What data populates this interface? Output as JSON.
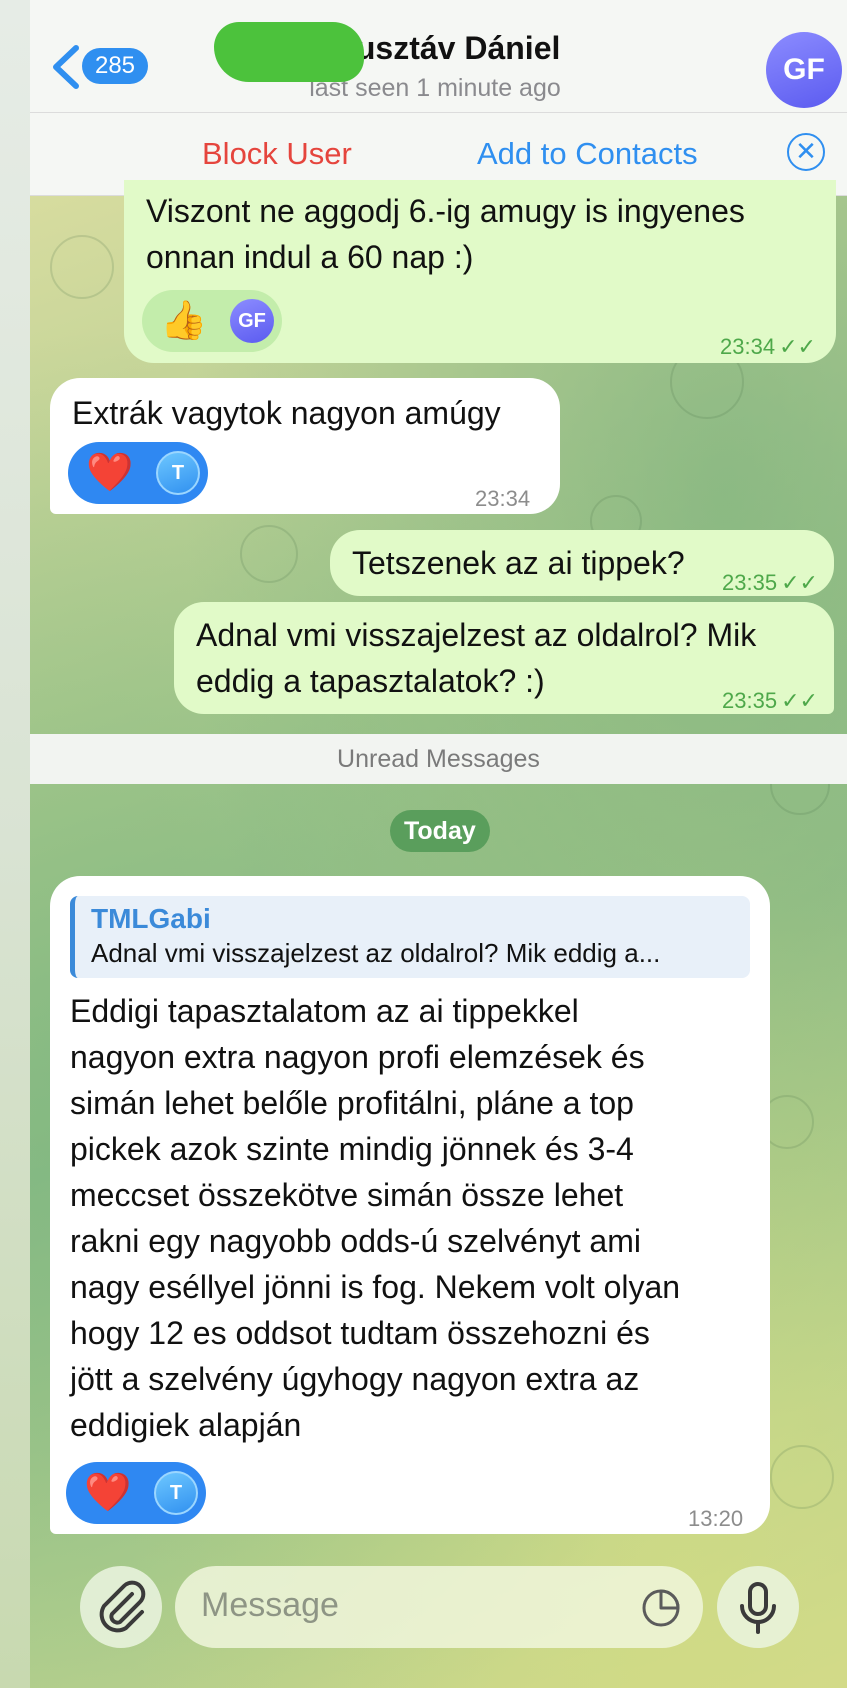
{
  "header": {
    "unread_count": "285",
    "contact_name": "r Gusztáv Dániel",
    "status": "last seen 1 minute ago",
    "avatar_initials": "GF"
  },
  "actions": {
    "block_user": "Block User",
    "add_to_contacts": "Add to Contacts"
  },
  "messages": [
    {
      "direction": "outgoing",
      "text_lines": [
        "Viszont ne aggodj 6.-ig amugy is ingyenes",
        "onnan indul a 60 nap :)"
      ],
      "reaction_emoji": "👍",
      "reaction_user": "GF",
      "time": "23:34",
      "read": true
    },
    {
      "direction": "incoming",
      "text": "Extrák vagytok nagyon amúgy",
      "reaction_emoji": "❤️",
      "reaction_user": "T",
      "time": "23:34"
    },
    {
      "direction": "outgoing",
      "text": "Tetszenek az ai tippek?",
      "time": "23:35",
      "read": true
    },
    {
      "direction": "outgoing",
      "text_lines": [
        "Adnal vmi visszajelzest az oldalrol? Mik",
        "eddig a tapasztalatok? :)"
      ],
      "time": "23:35",
      "read": true
    }
  ],
  "unread_separator": "Unread Messages",
  "date_separator": "Today",
  "reply_message": {
    "quoted_author": "TMLGabi",
    "quoted_text": "Adnal vmi visszajelzest az oldalrol? Mik eddig a...",
    "text_lines": [
      "Eddigi tapasztalatom az ai tippekkel",
      "nagyon extra nagyon profi elemzések és",
      "simán lehet belőle profitálni, pláne a top",
      "pickek azok szinte mindig jönnek és 3-4",
      "meccset összekötve simán össze lehet",
      "rakni egy nagyobb odds-ú szelvényt ami",
      "nagy eséllyel jönni is fog. Nekem volt olyan",
      "hogy 12 es oddsot tudtam összehozni és",
      "jött a szelvény úgyhogy nagyon extra az",
      "eddigiek alapján"
    ],
    "reaction_emoji": "❤️",
    "reaction_user": "T",
    "time": "13:20"
  },
  "composer": {
    "placeholder": "Message"
  },
  "colors": {
    "accent": "#2f8ff0",
    "danger": "#e5453d",
    "outgoing_bubble": "#e1fac8",
    "read_ticks": "#4ea84a"
  },
  "icons": [
    "back-chevron-icon",
    "close-circle-icon",
    "paperclip-icon",
    "sticker-clock-icon",
    "microphone-icon",
    "double-check-icon"
  ]
}
